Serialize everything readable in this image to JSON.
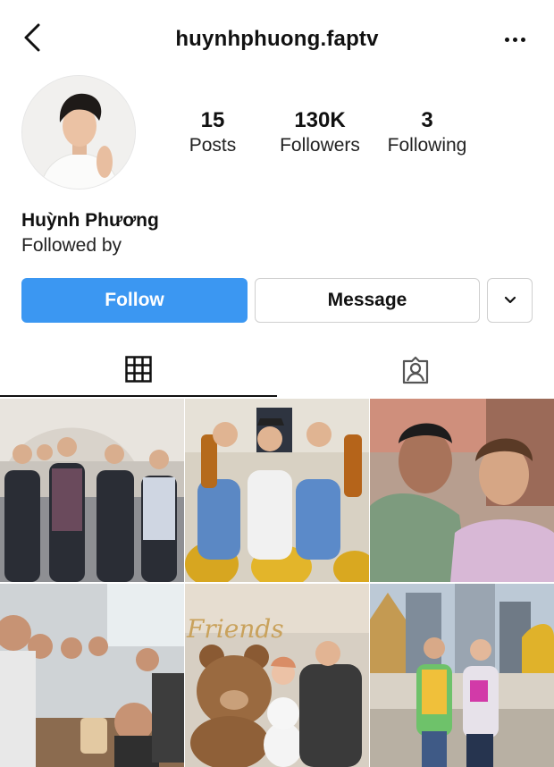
{
  "header": {
    "username": "huynhphuong.faptv",
    "back_icon": "chevron-left-icon",
    "more_icon": "more-horizontal-icon"
  },
  "profile": {
    "full_name": "Huỳnh Phương",
    "followed_by": "Followed by",
    "stats": [
      {
        "value": "15",
        "label": "Posts"
      },
      {
        "value": "130K",
        "label": "Followers"
      },
      {
        "value": "3",
        "label": "Following"
      }
    ]
  },
  "actions": {
    "follow_label": "Follow",
    "message_label": "Message",
    "suggest_icon": "chevron-down-icon"
  },
  "tabs": [
    {
      "icon": "grid-icon",
      "active": true
    },
    {
      "icon": "tagged-person-icon",
      "active": false
    }
  ],
  "colors": {
    "follow_button": "#3b97f2",
    "border": "#cfcfcf",
    "text": "#111111"
  }
}
